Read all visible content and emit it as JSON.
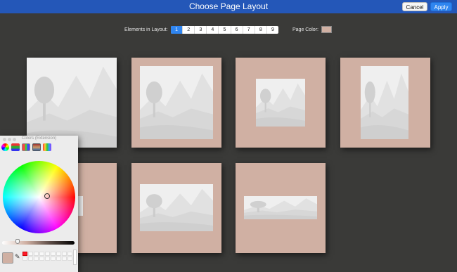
{
  "header": {
    "title": "Choose Page Layout",
    "cancel_label": "Cancel",
    "apply_label": "Apply"
  },
  "toolbar": {
    "elements_label": "Elements in Layout:",
    "counts": [
      "1",
      "2",
      "3",
      "4",
      "5",
      "6",
      "7",
      "8",
      "9"
    ],
    "selected_count": "1",
    "page_color_label": "Page Color:",
    "page_color": "#d0b0a3"
  },
  "layouts": [
    {
      "name": "full-bleed"
    },
    {
      "name": "large-inset"
    },
    {
      "name": "small-centered"
    },
    {
      "name": "portrait-inset"
    },
    {
      "name": "partially-hidden"
    },
    {
      "name": "landscape-inset"
    },
    {
      "name": "panoramic-strip"
    }
  ],
  "color_panel": {
    "title": "Colors (Extension)",
    "tool_icons": [
      "color-wheel-icon",
      "color-sliders-icon",
      "color-palettes-icon",
      "image-palettes-icon",
      "crayons-icon"
    ],
    "current_color": "#d0b0a3",
    "saved_swatch_color": "#ff1a2a"
  },
  "colors": {
    "titlebar": "#2457b8",
    "background": "#3a3a38",
    "accent": "#2f85f0"
  }
}
